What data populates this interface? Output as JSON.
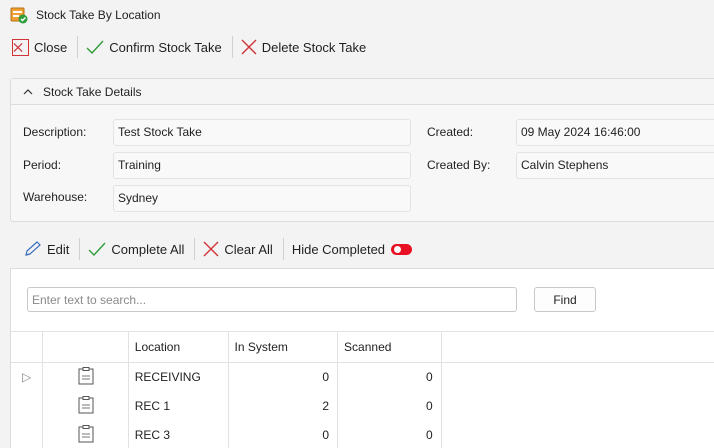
{
  "window": {
    "title": "Stock Take By Location",
    "icon": "stock-take-app-icon"
  },
  "toolbar": {
    "close_label": "Close",
    "confirm_label": "Confirm Stock Take",
    "delete_label": "Delete Stock Take"
  },
  "details": {
    "header": "Stock Take Details",
    "description_label": "Description:",
    "description_value": "Test Stock Take",
    "period_label": "Period:",
    "period_value": "Training",
    "warehouse_label": "Warehouse:",
    "warehouse_value": "Sydney",
    "created_label": "Created:",
    "created_value": "09 May 2024 16:46:00",
    "created_by_label": "Created By:",
    "created_by_value": "Calvin Stephens"
  },
  "grid_toolbar": {
    "edit_label": "Edit",
    "complete_all_label": "Complete All",
    "clear_all_label": "Clear All",
    "hide_completed_label": "Hide Completed",
    "hide_completed_on": true
  },
  "search": {
    "placeholder": "Enter text to search...",
    "find_label": "Find"
  },
  "table": {
    "columns": [
      "Location",
      "In System",
      "Scanned"
    ],
    "rows": [
      {
        "location": "RECEIVING",
        "in_system": "0",
        "scanned": "0",
        "expander": "▷"
      },
      {
        "location": "REC 1",
        "in_system": "2",
        "scanned": "0",
        "expander": ""
      },
      {
        "location": "REC 3",
        "in_system": "0",
        "scanned": "0",
        "expander": ""
      }
    ]
  },
  "colors": {
    "accent_green": "#2e9d3a",
    "danger_red": "#d13438",
    "toggle_red": "#e81123",
    "edit_blue": "#3a6fbf"
  }
}
